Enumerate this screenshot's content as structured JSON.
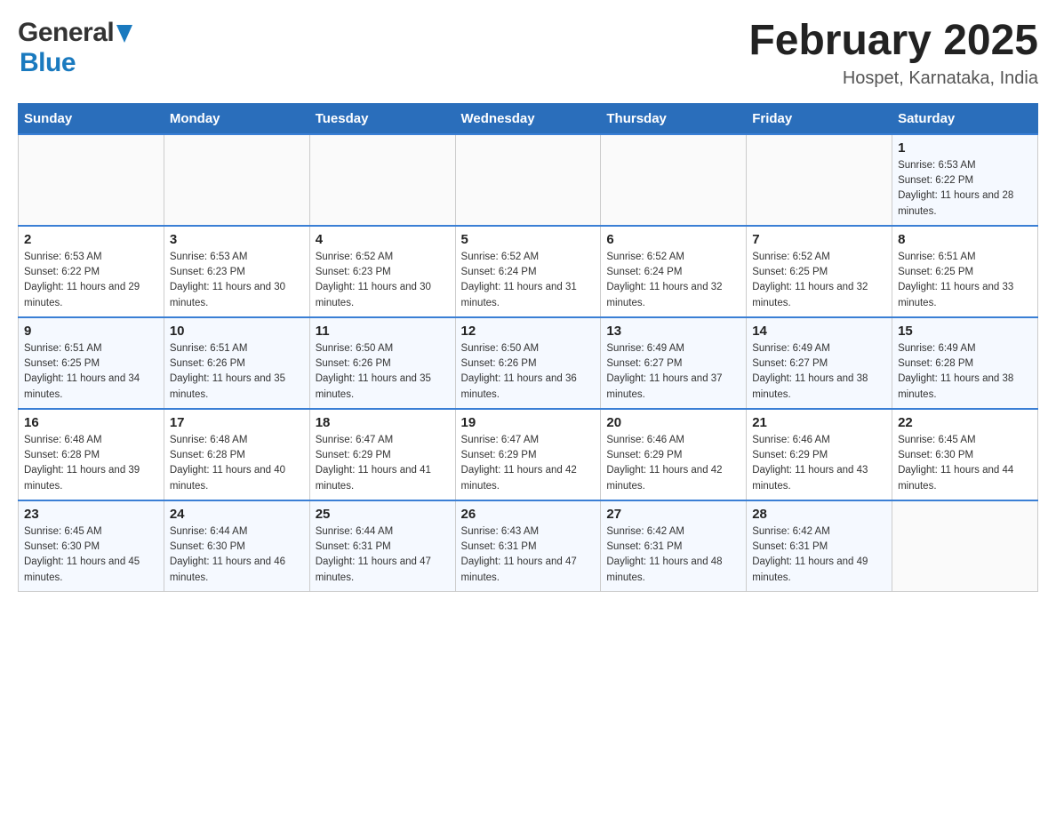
{
  "header": {
    "logo_general": "General",
    "logo_blue": "Blue",
    "month_title": "February 2025",
    "location": "Hospet, Karnataka, India"
  },
  "weekdays": [
    "Sunday",
    "Monday",
    "Tuesday",
    "Wednesday",
    "Thursday",
    "Friday",
    "Saturday"
  ],
  "weeks": [
    [
      {
        "day": "",
        "sunrise": "",
        "sunset": "",
        "daylight": ""
      },
      {
        "day": "",
        "sunrise": "",
        "sunset": "",
        "daylight": ""
      },
      {
        "day": "",
        "sunrise": "",
        "sunset": "",
        "daylight": ""
      },
      {
        "day": "",
        "sunrise": "",
        "sunset": "",
        "daylight": ""
      },
      {
        "day": "",
        "sunrise": "",
        "sunset": "",
        "daylight": ""
      },
      {
        "day": "",
        "sunrise": "",
        "sunset": "",
        "daylight": ""
      },
      {
        "day": "1",
        "sunrise": "Sunrise: 6:53 AM",
        "sunset": "Sunset: 6:22 PM",
        "daylight": "Daylight: 11 hours and 28 minutes."
      }
    ],
    [
      {
        "day": "2",
        "sunrise": "Sunrise: 6:53 AM",
        "sunset": "Sunset: 6:22 PM",
        "daylight": "Daylight: 11 hours and 29 minutes."
      },
      {
        "day": "3",
        "sunrise": "Sunrise: 6:53 AM",
        "sunset": "Sunset: 6:23 PM",
        "daylight": "Daylight: 11 hours and 30 minutes."
      },
      {
        "day": "4",
        "sunrise": "Sunrise: 6:52 AM",
        "sunset": "Sunset: 6:23 PM",
        "daylight": "Daylight: 11 hours and 30 minutes."
      },
      {
        "day": "5",
        "sunrise": "Sunrise: 6:52 AM",
        "sunset": "Sunset: 6:24 PM",
        "daylight": "Daylight: 11 hours and 31 minutes."
      },
      {
        "day": "6",
        "sunrise": "Sunrise: 6:52 AM",
        "sunset": "Sunset: 6:24 PM",
        "daylight": "Daylight: 11 hours and 32 minutes."
      },
      {
        "day": "7",
        "sunrise": "Sunrise: 6:52 AM",
        "sunset": "Sunset: 6:25 PM",
        "daylight": "Daylight: 11 hours and 32 minutes."
      },
      {
        "day": "8",
        "sunrise": "Sunrise: 6:51 AM",
        "sunset": "Sunset: 6:25 PM",
        "daylight": "Daylight: 11 hours and 33 minutes."
      }
    ],
    [
      {
        "day": "9",
        "sunrise": "Sunrise: 6:51 AM",
        "sunset": "Sunset: 6:25 PM",
        "daylight": "Daylight: 11 hours and 34 minutes."
      },
      {
        "day": "10",
        "sunrise": "Sunrise: 6:51 AM",
        "sunset": "Sunset: 6:26 PM",
        "daylight": "Daylight: 11 hours and 35 minutes."
      },
      {
        "day": "11",
        "sunrise": "Sunrise: 6:50 AM",
        "sunset": "Sunset: 6:26 PM",
        "daylight": "Daylight: 11 hours and 35 minutes."
      },
      {
        "day": "12",
        "sunrise": "Sunrise: 6:50 AM",
        "sunset": "Sunset: 6:26 PM",
        "daylight": "Daylight: 11 hours and 36 minutes."
      },
      {
        "day": "13",
        "sunrise": "Sunrise: 6:49 AM",
        "sunset": "Sunset: 6:27 PM",
        "daylight": "Daylight: 11 hours and 37 minutes."
      },
      {
        "day": "14",
        "sunrise": "Sunrise: 6:49 AM",
        "sunset": "Sunset: 6:27 PM",
        "daylight": "Daylight: 11 hours and 38 minutes."
      },
      {
        "day": "15",
        "sunrise": "Sunrise: 6:49 AM",
        "sunset": "Sunset: 6:28 PM",
        "daylight": "Daylight: 11 hours and 38 minutes."
      }
    ],
    [
      {
        "day": "16",
        "sunrise": "Sunrise: 6:48 AM",
        "sunset": "Sunset: 6:28 PM",
        "daylight": "Daylight: 11 hours and 39 minutes."
      },
      {
        "day": "17",
        "sunrise": "Sunrise: 6:48 AM",
        "sunset": "Sunset: 6:28 PM",
        "daylight": "Daylight: 11 hours and 40 minutes."
      },
      {
        "day": "18",
        "sunrise": "Sunrise: 6:47 AM",
        "sunset": "Sunset: 6:29 PM",
        "daylight": "Daylight: 11 hours and 41 minutes."
      },
      {
        "day": "19",
        "sunrise": "Sunrise: 6:47 AM",
        "sunset": "Sunset: 6:29 PM",
        "daylight": "Daylight: 11 hours and 42 minutes."
      },
      {
        "day": "20",
        "sunrise": "Sunrise: 6:46 AM",
        "sunset": "Sunset: 6:29 PM",
        "daylight": "Daylight: 11 hours and 42 minutes."
      },
      {
        "day": "21",
        "sunrise": "Sunrise: 6:46 AM",
        "sunset": "Sunset: 6:29 PM",
        "daylight": "Daylight: 11 hours and 43 minutes."
      },
      {
        "day": "22",
        "sunrise": "Sunrise: 6:45 AM",
        "sunset": "Sunset: 6:30 PM",
        "daylight": "Daylight: 11 hours and 44 minutes."
      }
    ],
    [
      {
        "day": "23",
        "sunrise": "Sunrise: 6:45 AM",
        "sunset": "Sunset: 6:30 PM",
        "daylight": "Daylight: 11 hours and 45 minutes."
      },
      {
        "day": "24",
        "sunrise": "Sunrise: 6:44 AM",
        "sunset": "Sunset: 6:30 PM",
        "daylight": "Daylight: 11 hours and 46 minutes."
      },
      {
        "day": "25",
        "sunrise": "Sunrise: 6:44 AM",
        "sunset": "Sunset: 6:31 PM",
        "daylight": "Daylight: 11 hours and 47 minutes."
      },
      {
        "day": "26",
        "sunrise": "Sunrise: 6:43 AM",
        "sunset": "Sunset: 6:31 PM",
        "daylight": "Daylight: 11 hours and 47 minutes."
      },
      {
        "day": "27",
        "sunrise": "Sunrise: 6:42 AM",
        "sunset": "Sunset: 6:31 PM",
        "daylight": "Daylight: 11 hours and 48 minutes."
      },
      {
        "day": "28",
        "sunrise": "Sunrise: 6:42 AM",
        "sunset": "Sunset: 6:31 PM",
        "daylight": "Daylight: 11 hours and 49 minutes."
      },
      {
        "day": "",
        "sunrise": "",
        "sunset": "",
        "daylight": ""
      }
    ]
  ]
}
